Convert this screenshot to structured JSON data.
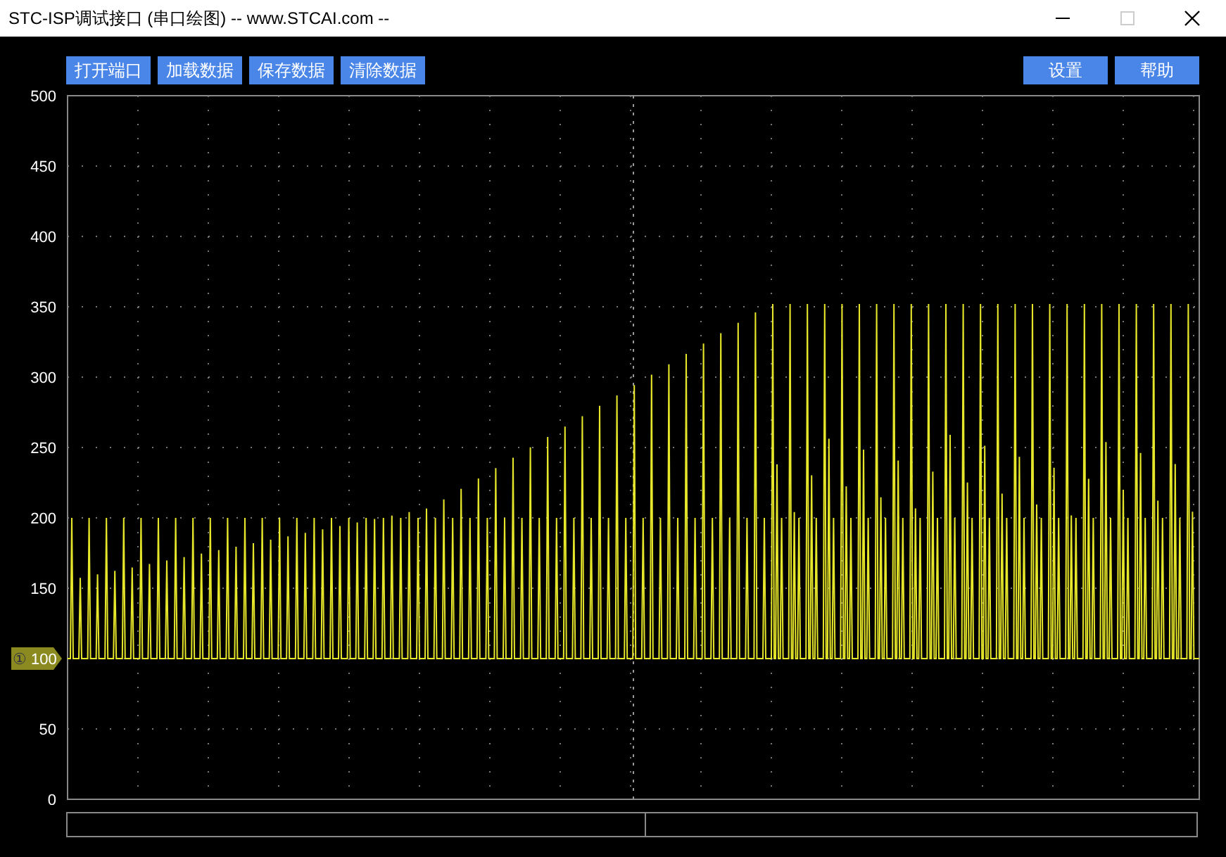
{
  "window": {
    "title": "STC-ISP调试接口 (串口绘图) -- www.STCAI.com --",
    "maximize_disabled": true
  },
  "toolbar": {
    "left_buttons": [
      "打开端口",
      "加载数据",
      "保存数据",
      "清除数据"
    ],
    "right_buttons": [
      "设置",
      "帮助"
    ]
  },
  "plot": {
    "y_axis": [
      {
        "kind": "tick",
        "label": "500"
      },
      {
        "kind": "tick",
        "label": "450"
      },
      {
        "kind": "tick",
        "label": "400"
      },
      {
        "kind": "tick",
        "label": "350"
      },
      {
        "kind": "tick",
        "label": "300"
      },
      {
        "kind": "tick",
        "label": "250"
      },
      {
        "kind": "tick",
        "label": "200"
      },
      {
        "kind": "tick",
        "label": "150"
      },
      {
        "kind": "channel_marker",
        "symbol": "①",
        "label": "100"
      },
      {
        "kind": "tick",
        "label": "50"
      },
      {
        "kind": "tick",
        "label": "0"
      }
    ]
  }
}
